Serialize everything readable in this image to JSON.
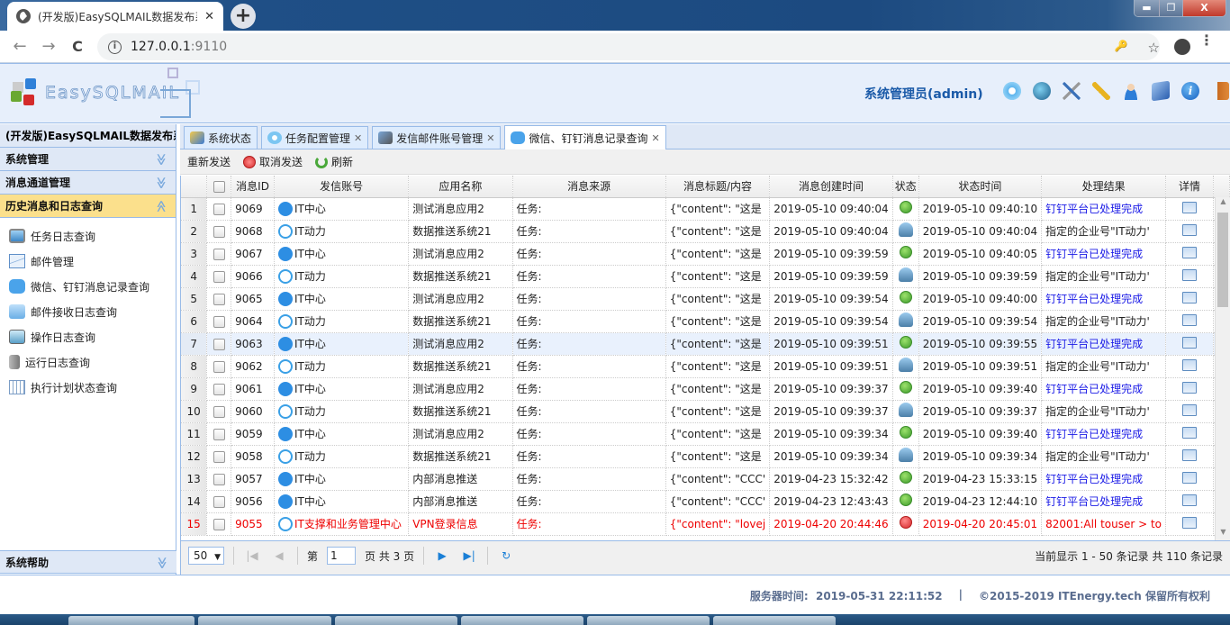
{
  "browser": {
    "tab_title": "(开发版)EasySQLMAIL数据发布系",
    "tab_close": "✕",
    "new_tab": "+",
    "url_host": "127.0.0.1",
    "url_port": ":9110",
    "back": "←",
    "forward": "→",
    "reload": "C",
    "key_icon": "🔑",
    "star_icon": "☆",
    "menu_icon": "⋮",
    "win_min": "▬",
    "win_max": "❐",
    "win_close": "X"
  },
  "header": {
    "logo_text": "EasySQLMAIL",
    "user_label": "系统管理员(admin)",
    "tool_icons": [
      "settings-gear",
      "globe",
      "tools",
      "keys",
      "user",
      "box",
      "info",
      "exit-door"
    ]
  },
  "sidebar": {
    "title": "(开发版)EasySQLMAIL数据发布系统",
    "sections": [
      {
        "label": "系统管理",
        "chevron": "≫"
      },
      {
        "label": "消息通道管理",
        "chevron": "≫"
      },
      {
        "label": "历史消息和日志查询",
        "chevron": "≪"
      }
    ],
    "items": [
      {
        "label": "任务日志查询",
        "icon": "monitor"
      },
      {
        "label": "邮件管理",
        "icon": "envelope"
      },
      {
        "label": "微信、钉钉消息记录查询",
        "icon": "chat-bubble"
      },
      {
        "label": "邮件接收日志查询",
        "icon": "folder-search"
      },
      {
        "label": "操作日志查询",
        "icon": "screen"
      },
      {
        "label": "运行日志查询",
        "icon": "database"
      },
      {
        "label": "执行计划状态查询",
        "icon": "calendar-grid"
      }
    ],
    "help": {
      "label": "系统帮助",
      "chevron": "≫"
    }
  },
  "tabs": [
    {
      "label": "系统状态",
      "closable": false,
      "active": false
    },
    {
      "label": "任务配置管理",
      "closable": true,
      "active": false
    },
    {
      "label": "发信邮件账号管理",
      "closable": true,
      "active": false
    },
    {
      "label": "微信、钉钉消息记录查询",
      "closable": true,
      "active": true
    }
  ],
  "toolbar": {
    "resend": "重新发送",
    "cancel": "取消发送",
    "refresh": "刷新"
  },
  "grid": {
    "columns": [
      "",
      "",
      "消息ID",
      "发信账号",
      "应用名称",
      "消息来源",
      "消息标题/内容",
      "消息创建时间",
      "状态",
      "状态时间",
      "处理结果",
      "详情"
    ],
    "rows": [
      {
        "n": "1",
        "id": "9069",
        "acct_type": "dingtalk",
        "acct": "IT中心",
        "app": "测试消息应用2",
        "src": "任务:",
        "content": "{\"content\": \"这是",
        "created": "2019-05-10 09:40:04",
        "status": "ok",
        "status_time": "2019-05-10 09:40:10",
        "result": "钉钉平台已处理完成",
        "result_blue": true,
        "error": false
      },
      {
        "n": "2",
        "id": "9068",
        "acct_type": "wechat",
        "acct": "IT动力",
        "app": "数据推送系统21",
        "src": "任务:",
        "content": "{\"content\": \"这是",
        "created": "2019-05-10 09:40:04",
        "status": "wait",
        "status_time": "2019-05-10 09:40:04",
        "result": "指定的企业号\"IT动力'",
        "result_blue": false,
        "error": false
      },
      {
        "n": "3",
        "id": "9067",
        "acct_type": "dingtalk",
        "acct": "IT中心",
        "app": "测试消息应用2",
        "src": "任务:",
        "content": "{\"content\": \"这是",
        "created": "2019-05-10 09:39:59",
        "status": "ok",
        "status_time": "2019-05-10 09:40:05",
        "result": "钉钉平台已处理完成",
        "result_blue": true,
        "error": false
      },
      {
        "n": "4",
        "id": "9066",
        "acct_type": "wechat",
        "acct": "IT动力",
        "app": "数据推送系统21",
        "src": "任务:",
        "content": "{\"content\": \"这是",
        "created": "2019-05-10 09:39:59",
        "status": "wait",
        "status_time": "2019-05-10 09:39:59",
        "result": "指定的企业号\"IT动力'",
        "result_blue": false,
        "error": false
      },
      {
        "n": "5",
        "id": "9065",
        "acct_type": "dingtalk",
        "acct": "IT中心",
        "app": "测试消息应用2",
        "src": "任务:",
        "content": "{\"content\": \"这是",
        "created": "2019-05-10 09:39:54",
        "status": "ok",
        "status_time": "2019-05-10 09:40:00",
        "result": "钉钉平台已处理完成",
        "result_blue": true,
        "error": false
      },
      {
        "n": "6",
        "id": "9064",
        "acct_type": "wechat",
        "acct": "IT动力",
        "app": "数据推送系统21",
        "src": "任务:",
        "content": "{\"content\": \"这是",
        "created": "2019-05-10 09:39:54",
        "status": "wait",
        "status_time": "2019-05-10 09:39:54",
        "result": "指定的企业号\"IT动力'",
        "result_blue": false,
        "error": false
      },
      {
        "n": "7",
        "id": "9063",
        "acct_type": "dingtalk",
        "acct": "IT中心",
        "app": "测试消息应用2",
        "src": "任务:",
        "content": "{\"content\": \"这是",
        "created": "2019-05-10 09:39:51",
        "status": "ok",
        "status_time": "2019-05-10 09:39:55",
        "result": "钉钉平台已处理完成",
        "result_blue": true,
        "error": false,
        "highlight": true
      },
      {
        "n": "8",
        "id": "9062",
        "acct_type": "wechat",
        "acct": "IT动力",
        "app": "数据推送系统21",
        "src": "任务:",
        "content": "{\"content\": \"这是",
        "created": "2019-05-10 09:39:51",
        "status": "wait",
        "status_time": "2019-05-10 09:39:51",
        "result": "指定的企业号\"IT动力'",
        "result_blue": false,
        "error": false
      },
      {
        "n": "9",
        "id": "9061",
        "acct_type": "dingtalk",
        "acct": "IT中心",
        "app": "测试消息应用2",
        "src": "任务:",
        "content": "{\"content\": \"这是",
        "created": "2019-05-10 09:39:37",
        "status": "ok",
        "status_time": "2019-05-10 09:39:40",
        "result": "钉钉平台已处理完成",
        "result_blue": true,
        "error": false
      },
      {
        "n": "10",
        "id": "9060",
        "acct_type": "wechat",
        "acct": "IT动力",
        "app": "数据推送系统21",
        "src": "任务:",
        "content": "{\"content\": \"这是",
        "created": "2019-05-10 09:39:37",
        "status": "wait",
        "status_time": "2019-05-10 09:39:37",
        "result": "指定的企业号\"IT动力'",
        "result_blue": false,
        "error": false
      },
      {
        "n": "11",
        "id": "9059",
        "acct_type": "dingtalk",
        "acct": "IT中心",
        "app": "测试消息应用2",
        "src": "任务:",
        "content": "{\"content\": \"这是",
        "created": "2019-05-10 09:39:34",
        "status": "ok",
        "status_time": "2019-05-10 09:39:40",
        "result": "钉钉平台已处理完成",
        "result_blue": true,
        "error": false
      },
      {
        "n": "12",
        "id": "9058",
        "acct_type": "wechat",
        "acct": "IT动力",
        "app": "数据推送系统21",
        "src": "任务:",
        "content": "{\"content\": \"这是",
        "created": "2019-05-10 09:39:34",
        "status": "wait",
        "status_time": "2019-05-10 09:39:34",
        "result": "指定的企业号\"IT动力'",
        "result_blue": false,
        "error": false
      },
      {
        "n": "13",
        "id": "9057",
        "acct_type": "dingtalk",
        "acct": "IT中心",
        "app": "内部消息推送",
        "src": "任务:",
        "content": "{\"content\": \"CCC'",
        "created": "2019-04-23 15:32:42",
        "status": "ok",
        "status_time": "2019-04-23 15:33:15",
        "result": "钉钉平台已处理完成",
        "result_blue": true,
        "error": false
      },
      {
        "n": "14",
        "id": "9056",
        "acct_type": "dingtalk",
        "acct": "IT中心",
        "app": "内部消息推送",
        "src": "任务:",
        "content": "{\"content\": \"CCC'",
        "created": "2019-04-23 12:43:43",
        "status": "ok",
        "status_time": "2019-04-23 12:44:10",
        "result": "钉钉平台已处理完成",
        "result_blue": true,
        "error": false
      },
      {
        "n": "15",
        "id": "9055",
        "acct_type": "wechat",
        "acct": "IT支撑和业务管理中心",
        "app": "VPN登录信息",
        "src": "任务:",
        "content": "{\"content\": \"lovej",
        "created": "2019-04-20 20:44:46",
        "status": "err",
        "status_time": "2019-04-20 20:45:01",
        "result": "82001:All touser > to",
        "result_blue": false,
        "error": true
      }
    ]
  },
  "pager": {
    "page_size": "50",
    "page_prefix": "第",
    "page": "1",
    "page_suffix": "页 共 3 页",
    "records": "当前显示 1 - 50 条记录 共 110 条记录"
  },
  "footer": {
    "server_time_label": "服务器时间:",
    "server_time": "2019-05-31 22:11:52",
    "divider": "|",
    "copyright": "©2015-2019 ITEnergy.tech 保留所有权利"
  }
}
